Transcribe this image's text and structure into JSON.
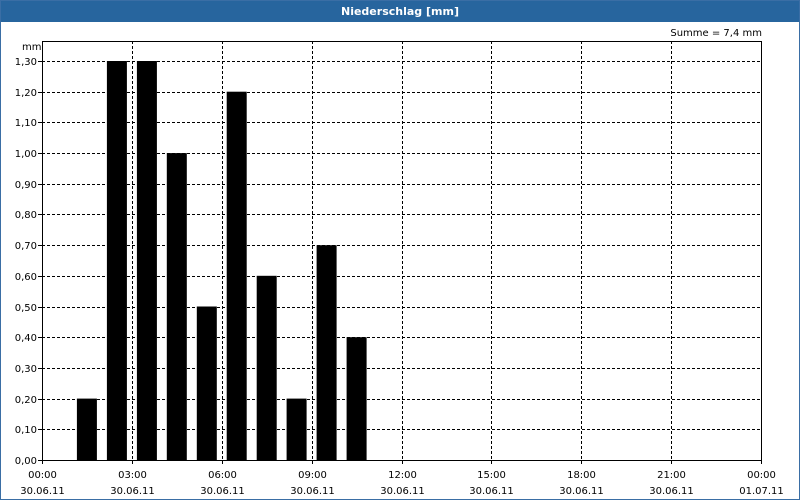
{
  "window": {
    "title": "Niederschlag [mm]"
  },
  "chart_data": {
    "type": "bar",
    "title": "Niederschlag [mm]",
    "unit_label": "mm",
    "annotation": "Summe = 7,4 mm",
    "xlabel": "",
    "ylabel": "mm",
    "x_hours": [
      1.5,
      2.5,
      3.5,
      4.5,
      5.5,
      6.5,
      7.5,
      8.5,
      9.5,
      10.5
    ],
    "values": [
      0.2,
      1.3,
      1.3,
      1.0,
      0.5,
      1.2,
      0.6,
      0.2,
      0.7,
      0.4
    ],
    "ylim": [
      0,
      1.3
    ],
    "xlim_hours": [
      0,
      24
    ],
    "y_ticks": [
      "0,00",
      "0,10",
      "0,20",
      "0,30",
      "0,40",
      "0,50",
      "0,60",
      "0,70",
      "0,80",
      "0,90",
      "1,00",
      "1,10",
      "1,20",
      "1,30"
    ],
    "x_ticks": [
      {
        "time": "00:00",
        "date": "30.06.11"
      },
      {
        "time": "03:00",
        "date": "30.06.11"
      },
      {
        "time": "06:00",
        "date": "30.06.11"
      },
      {
        "time": "09:00",
        "date": "30.06.11"
      },
      {
        "time": "12:00",
        "date": "30.06.11"
      },
      {
        "time": "15:00",
        "date": "30.06.11"
      },
      {
        "time": "18:00",
        "date": "30.06.11"
      },
      {
        "time": "21:00",
        "date": "30.06.11"
      },
      {
        "time": "00:00",
        "date": "01.07.11"
      }
    ],
    "grid": true,
    "bar_color": "#000000",
    "grid_color": "#000000"
  }
}
